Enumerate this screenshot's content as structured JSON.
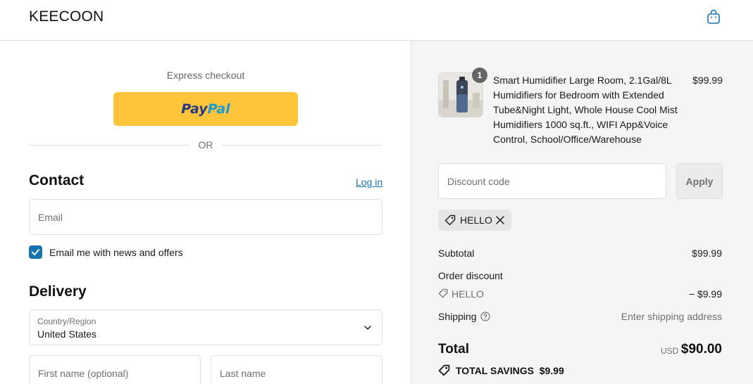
{
  "header": {
    "logo": "KEECOON",
    "cart_icon": "shopping-bag-icon"
  },
  "express": {
    "label": "Express checkout",
    "paypal_part1": "Pay",
    "paypal_part2": "Pal",
    "or_label": "OR"
  },
  "contact": {
    "title": "Contact",
    "login_label": "Log in",
    "email_placeholder": "Email",
    "newsletter_label": "Email me with news and offers",
    "newsletter_checked": true
  },
  "delivery": {
    "title": "Delivery",
    "country_label": "Country/Region",
    "country_value": "United States",
    "first_name_placeholder": "First name (optional)",
    "last_name_placeholder": "Last name"
  },
  "order": {
    "product": {
      "quantity": "1",
      "title": "Smart Humidifier Large Room, 2.1Gal/8L Humidifiers for Bedroom with Extended Tube&Night Light, Whole House Cool Mist Humidifiers 1000 sq.ft., WIFI App&Voice Control, School/Office/Warehouse",
      "price": "$99.99"
    },
    "discount_placeholder": "Discount code",
    "apply_label": "Apply",
    "applied_code": "HELLO",
    "subtotal_label": "Subtotal",
    "subtotal_value": "$99.99",
    "order_discount_label": "Order discount",
    "discount_code": "HELLO",
    "discount_value": "− $9.99",
    "shipping_label": "Shipping",
    "shipping_value": "Enter shipping address",
    "total_label": "Total",
    "total_currency": "USD",
    "total_value": "$90.00",
    "savings_label": "TOTAL SAVINGS",
    "savings_value": "$9.99"
  },
  "colors": {
    "accent": "#1773b0",
    "paypal_yellow": "#ffc439",
    "summary_bg": "#f5f5f5"
  }
}
